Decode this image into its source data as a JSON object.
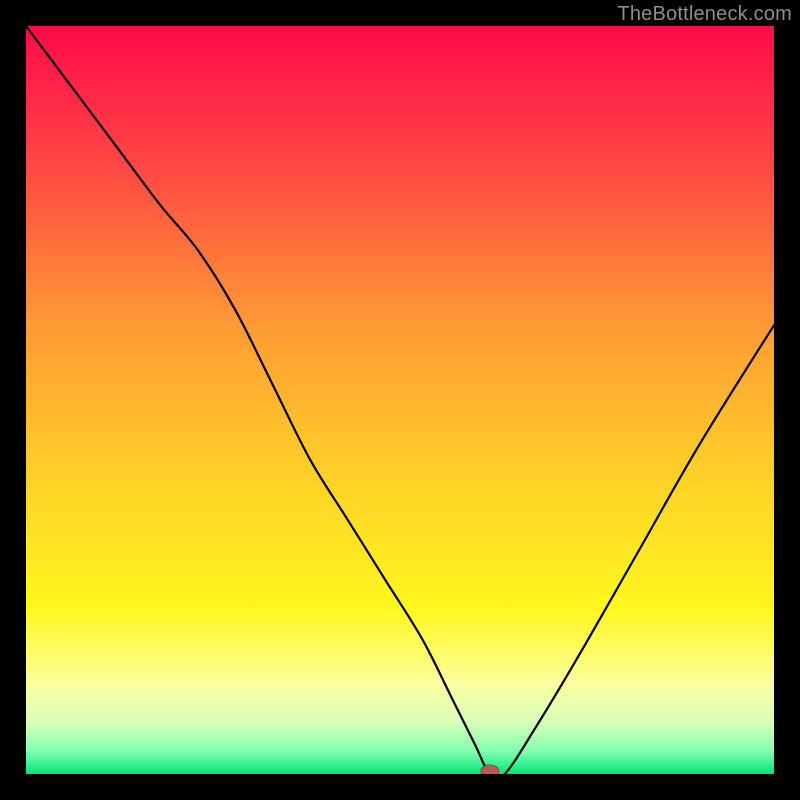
{
  "watermark": "TheBottleneck.com",
  "chart_data": {
    "type": "line",
    "title": "",
    "xlabel": "",
    "ylabel": "",
    "xlim": [
      0,
      100
    ],
    "ylim": [
      0,
      100
    ],
    "grid": false,
    "legend": false,
    "annotations": [
      {
        "name": "optimal-marker",
        "x": 62,
        "y": 0,
        "color": "#c05a5a"
      }
    ],
    "series": [
      {
        "name": "bottleneck-curve",
        "color": "#000000",
        "x": [
          0,
          6,
          12,
          18,
          23,
          28,
          33,
          38,
          43,
          48,
          53,
          57,
          60,
          62,
          64,
          68,
          74,
          82,
          90,
          100
        ],
        "y": [
          100,
          92,
          84,
          76,
          70,
          62,
          52,
          42,
          34,
          26,
          18,
          10,
          4,
          0,
          0,
          6,
          16,
          30,
          44,
          60
        ]
      }
    ],
    "background_gradient": {
      "stops": [
        {
          "pos": 0.0,
          "color": "#ff0b49"
        },
        {
          "pos": 0.18,
          "color": "#ff4545"
        },
        {
          "pos": 0.4,
          "color": "#ff9a35"
        },
        {
          "pos": 0.6,
          "color": "#ffd028"
        },
        {
          "pos": 0.78,
          "color": "#fff71e"
        },
        {
          "pos": 0.88,
          "color": "#fbffa0"
        },
        {
          "pos": 0.93,
          "color": "#d8ffb8"
        },
        {
          "pos": 0.97,
          "color": "#80ffb0"
        },
        {
          "pos": 1.0,
          "color": "#00e57a"
        }
      ]
    },
    "marker": {
      "color_fill": "#c05a5a",
      "color_stroke": "#9b3f3f",
      "rx": 9,
      "ry": 6
    }
  }
}
